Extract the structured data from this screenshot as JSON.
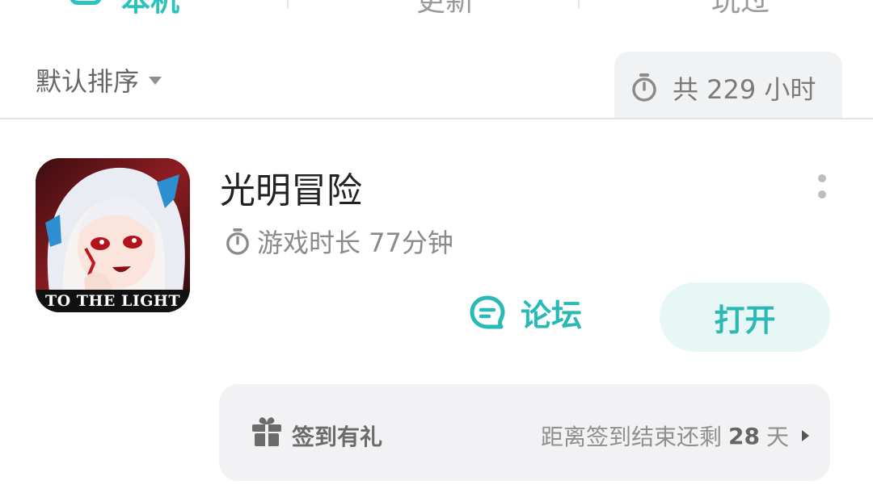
{
  "top_tabs": {
    "tab1_label": "本机",
    "tab2_label": "更新",
    "tab3_label": "玩过"
  },
  "sort": {
    "label": "默认排序"
  },
  "total": {
    "text": "共 229 小时"
  },
  "game": {
    "title": "光明冒险",
    "icon_caption": "TO THE LIGHT",
    "playtime": "游戏时长 77分钟",
    "forum_label": "论坛",
    "open_label": "打开"
  },
  "checkin": {
    "label": "签到有礼",
    "countdown_prefix": "距离签到结束还剩",
    "days": "28",
    "days_unit": "天"
  },
  "colors": {
    "accent": "#2ab9b6",
    "accent_bg": "#e6f7f6",
    "chip_bg": "#f1f2f4",
    "banner_bg": "#f2f2f5"
  }
}
